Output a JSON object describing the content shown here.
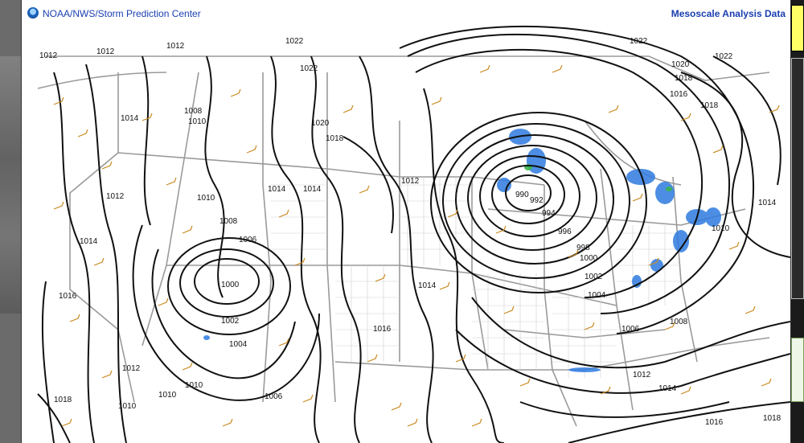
{
  "header": {
    "title": "NOAA/NWS/Storm Prediction Center",
    "right_link": "Mesoscale Analysis Data"
  },
  "colors": {
    "isobar": "#111111",
    "state_line": "#9a9a9a",
    "wind_barb": "#c98a20",
    "precip": "#2e7be0"
  },
  "map": {
    "isobar_labels": [
      "1012",
      "1012",
      "1012",
      "1022",
      "1022",
      "1022",
      "1020",
      "1018",
      "1016",
      "1018",
      "1022",
      "1008",
      "1010",
      "1014",
      "1020",
      "1018",
      "1014",
      "1014",
      "1012",
      "1012",
      "1010",
      "1008",
      "1006",
      "1014",
      "1000",
      "1002",
      "1004",
      "1012",
      "1010",
      "1010",
      "1016",
      "1018",
      "1010",
      "1006",
      "990",
      "992",
      "994",
      "996",
      "998",
      "1000",
      "1002",
      "1004",
      "1006",
      "1008",
      "1014",
      "1016",
      "1012",
      "1014",
      "1014",
      "1016",
      "1018",
      "1010"
    ]
  }
}
